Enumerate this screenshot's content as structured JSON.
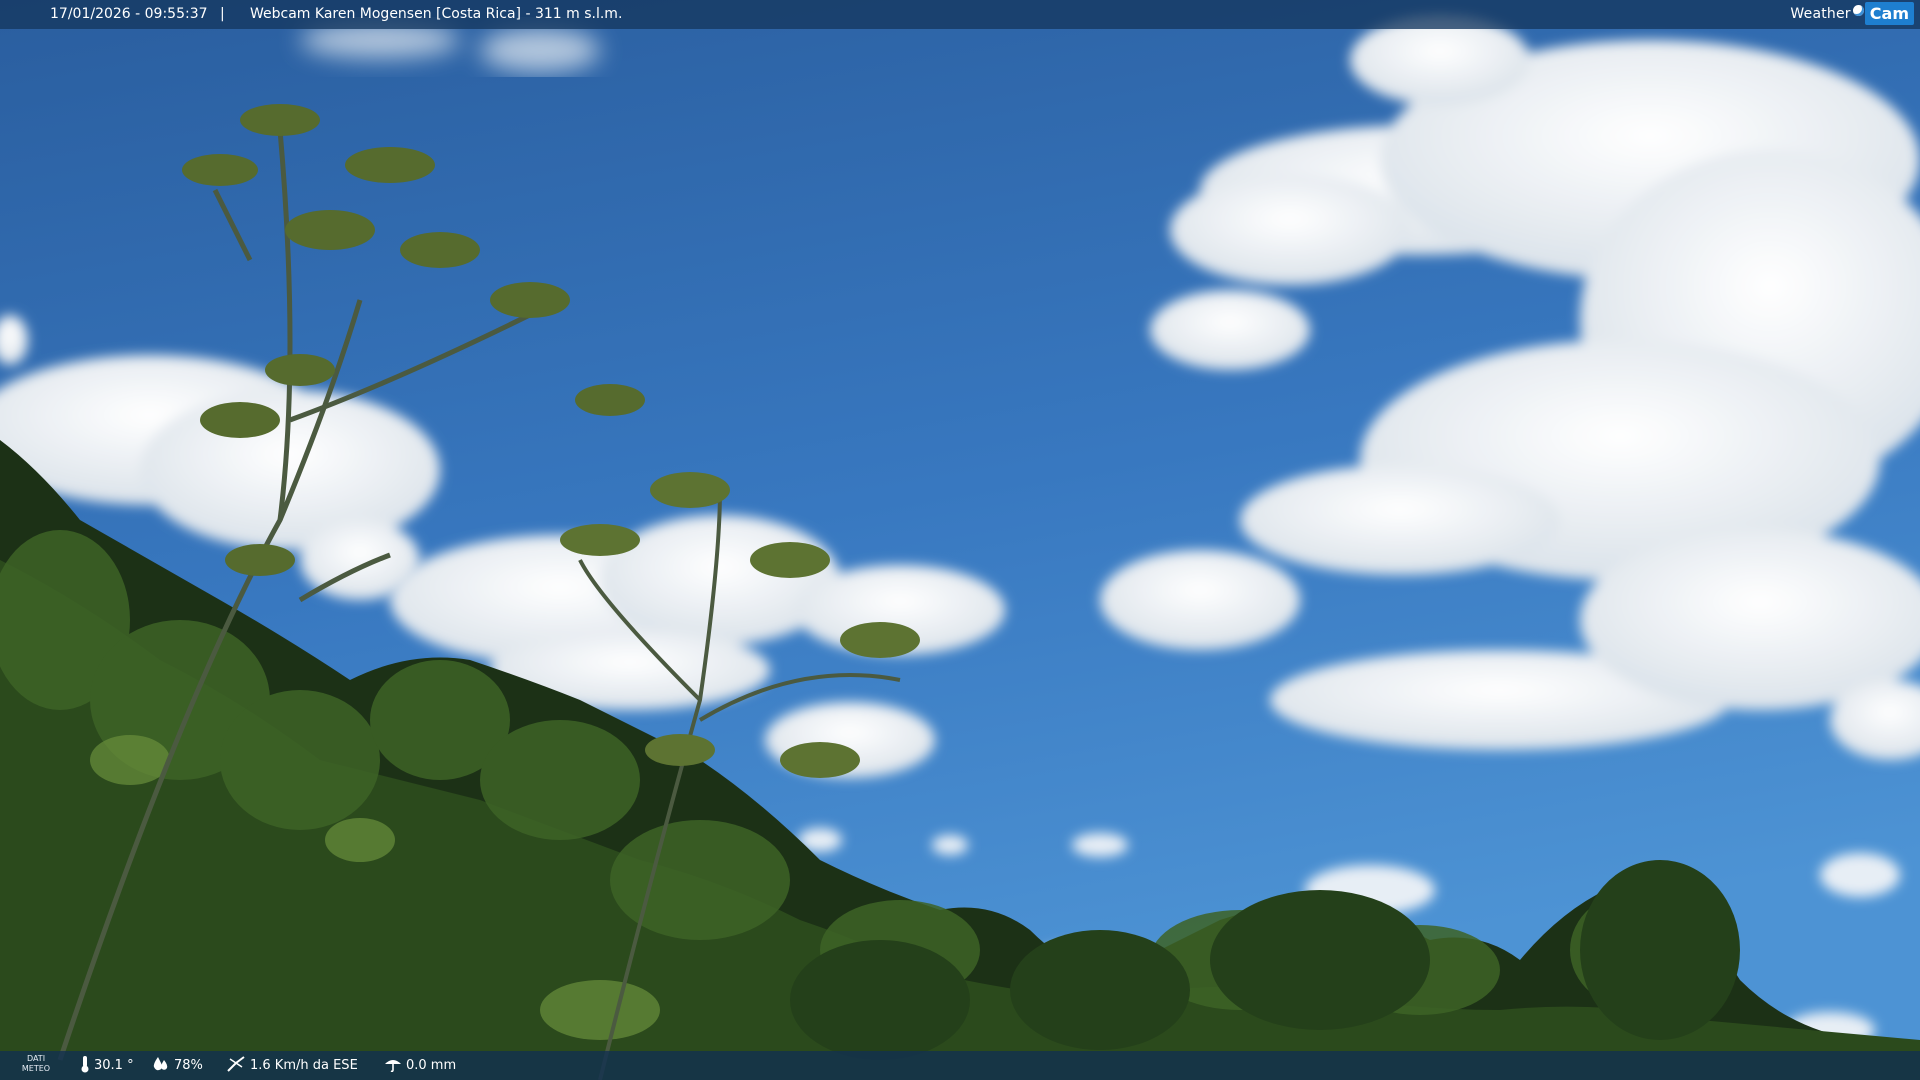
{
  "header": {
    "datetime": "17/01/2026 - 09:55:37",
    "separator": "|",
    "title": "Webcam Karen Mogensen [Costa Rica]  - 311 m s.l.m."
  },
  "logo": {
    "word_weather": "Weather",
    "word_cam": "Cam"
  },
  "footer": {
    "tag_line1": "DATI",
    "tag_line2": "METEO",
    "temperature": "30.1 °",
    "humidity": "78%",
    "wind": "1.6 Km/h da ESE",
    "rain": "0.0 mm"
  },
  "icons": {
    "temperature": "thermometer-icon",
    "humidity": "water-drop-icon",
    "wind": "wind-vane-icon",
    "rain": "rain-gauge-icon"
  },
  "colors": {
    "sky_top": "#2a62a6",
    "sky_bottom": "#4d93d4",
    "foliage_dark": "#1c3116",
    "foliage_mid": "#3a5c24",
    "bar_background": "#14375f"
  }
}
